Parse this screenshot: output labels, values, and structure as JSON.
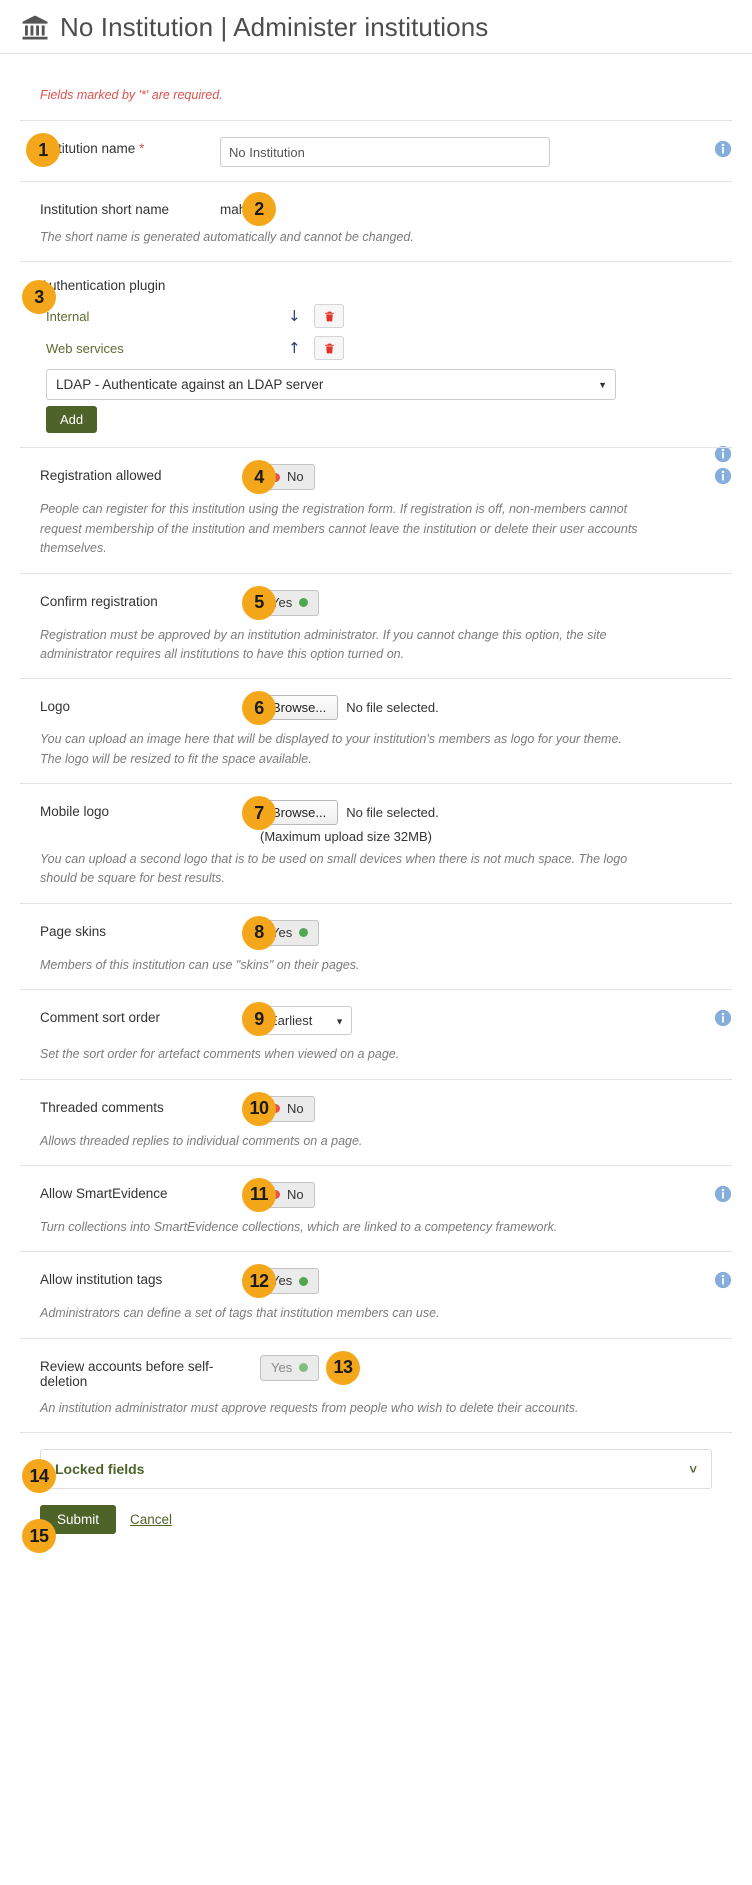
{
  "header": {
    "icon": "bank-icon",
    "title": "No Institution | Administer institutions"
  },
  "form": {
    "required_note": "Fields marked by '*' are required.",
    "fields": {
      "institution_name": {
        "label": "Institution name",
        "required_marker": "*",
        "value": "No Institution",
        "badge": "1"
      },
      "institution_short_name": {
        "label": "Institution short name",
        "value": "mahara",
        "help": "The short name is generated automatically and cannot be changed.",
        "badge": "2"
      },
      "authentication_plugin": {
        "label": "Authentication plugin",
        "badge": "3",
        "items": [
          {
            "name": "Internal",
            "arrow": "↓",
            "arrow_name": "move-down-arrow-icon"
          },
          {
            "name": "Web services",
            "arrow": "↑",
            "arrow_name": "move-up-arrow-icon"
          }
        ],
        "select_value": "LDAP - Authenticate against an LDAP server",
        "add_label": "Add"
      },
      "registration_allowed": {
        "label": "Registration allowed",
        "value": "No",
        "state": "off",
        "badge": "4",
        "help": "People can register for this institution using the registration form. If registration is off, non-members cannot request membership of the institution and members cannot leave the institution or delete their user accounts themselves."
      },
      "confirm_registration": {
        "label": "Confirm registration",
        "value": "Yes",
        "state": "on",
        "badge": "5",
        "help": "Registration must be approved by an institution administrator. If you cannot change this option, the site administrator requires all institutions to have this option turned on."
      },
      "logo": {
        "label": "Logo",
        "browse_label": "Browse...",
        "file_status": "No file selected.",
        "badge": "6",
        "help": "You can upload an image here that will be displayed to your institution's members as logo for your theme. The logo will be resized to fit the space available."
      },
      "mobile_logo": {
        "label": "Mobile logo",
        "browse_label": "Browse...",
        "file_status": "No file selected.",
        "max_upload": "(Maximum upload size 32MB)",
        "badge": "7",
        "help": "You can upload a second logo that is to be used on small devices when there is not much space. The logo should be square for best results."
      },
      "page_skins": {
        "label": "Page skins",
        "value": "Yes",
        "state": "on",
        "badge": "8",
        "help": "Members of this institution can use \"skins\" on their pages."
      },
      "comment_sort_order": {
        "label": "Comment sort order",
        "value": "Earliest",
        "badge": "9",
        "help": "Set the sort order for artefact comments when viewed on a page."
      },
      "threaded_comments": {
        "label": "Threaded comments",
        "value": "No",
        "state": "off",
        "badge": "10",
        "help": "Allows threaded replies to individual comments on a page."
      },
      "allow_smartevidence": {
        "label": "Allow SmartEvidence",
        "value": "No",
        "state": "off",
        "badge": "11",
        "help": "Turn collections into SmartEvidence collections, which are linked to a competency framework."
      },
      "allow_institution_tags": {
        "label": "Allow institution tags",
        "value": "Yes",
        "state": "on",
        "badge": "12",
        "help": "Administrators can define a set of tags that institution members can use."
      },
      "review_accounts_before_self_deletion": {
        "label": "Review accounts before self-deletion",
        "value": "Yes",
        "state": "on-disabled",
        "badge": "13",
        "help": "An institution administrator must approve requests from people who wish to delete their accounts."
      }
    },
    "locked_fields": {
      "title": "Locked fields",
      "badge": "14",
      "chevron": "⌄"
    },
    "actions": {
      "submit_label": "Submit",
      "cancel_label": "Cancel",
      "badge": "15"
    }
  },
  "colors": {
    "badge_bg": "#f5a71b",
    "accent_green": "#4d6328",
    "required_red": "#d9534f",
    "info_blue": "#85aedd",
    "trash_red": "#e53228",
    "status_on": "#4fa84f",
    "status_off": "#e8524a"
  }
}
